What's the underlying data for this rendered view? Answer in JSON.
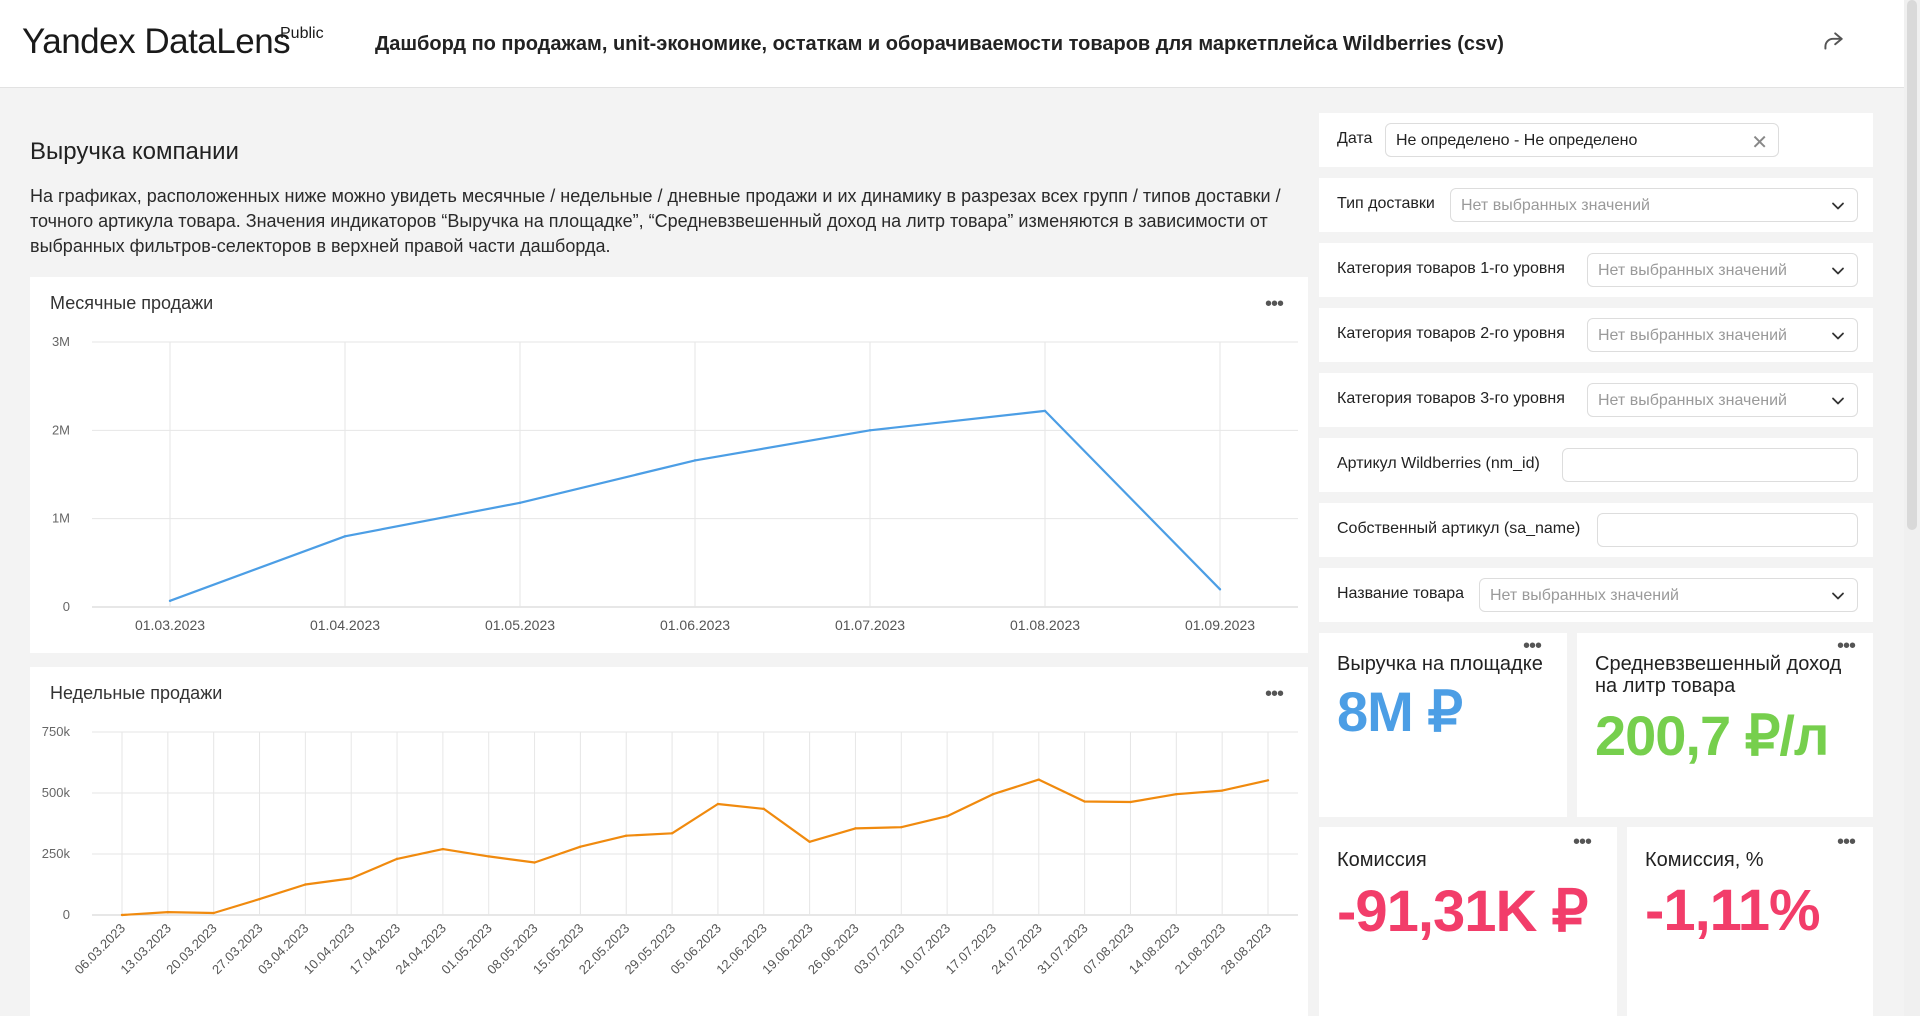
{
  "header": {
    "logo": "Yandex DataLens",
    "badge": "Public",
    "title": "Дашборд по продажам, unit-экономике, остаткам и оборачиваемости товаров для маркетплейса Wildberries (csv)"
  },
  "section": {
    "title": "Выручка компании",
    "description": "На графиках, расположенных ниже можно увидеть месячные / недельные / дневные продажи и их динамику в разрезах всех групп / типов доставки / точного артикула товара. Значения индикаторов “Выручка на площадке”, “Средневзвешенный доход на литр товара” изменяются в зависимости от выбранных фильтров-селекторов в верхней правой части дашборда."
  },
  "colors": {
    "line_monthly": "#4c9ee5",
    "line_weekly": "#f08a0e",
    "kpi_blue": "#4c9ee5",
    "kpi_green": "#76cf4d",
    "kpi_red": "#f23d6a"
  },
  "chart_data": [
    {
      "type": "line",
      "title": "Месячные продажи",
      "x": [
        "01.03.2023",
        "01.04.2023",
        "01.05.2023",
        "01.06.2023",
        "01.07.2023",
        "01.08.2023",
        "01.09.2023"
      ],
      "values": [
        70000,
        800000,
        1180000,
        1660000,
        2000000,
        2220000,
        200000
      ],
      "yticks": [
        "0",
        "1M",
        "2M",
        "3M"
      ],
      "ylim": [
        0,
        3000000
      ],
      "grid": true
    },
    {
      "type": "line",
      "title": "Недельные продажи",
      "x": [
        "06.03.2023",
        "13.03.2023",
        "20.03.2023",
        "27.03.2023",
        "03.04.2023",
        "10.04.2023",
        "17.04.2023",
        "24.04.2023",
        "01.05.2023",
        "08.05.2023",
        "15.05.2023",
        "22.05.2023",
        "29.05.2023",
        "05.06.2023",
        "12.06.2023",
        "19.06.2023",
        "26.06.2023",
        "03.07.2023",
        "10.07.2023",
        "17.07.2023",
        "24.07.2023",
        "31.07.2023",
        "07.08.2023",
        "14.08.2023",
        "21.08.2023",
        "28.08.2023"
      ],
      "values": [
        0,
        12000,
        8000,
        65000,
        125000,
        150000,
        230000,
        270000,
        240000,
        215000,
        280000,
        325000,
        335000,
        455000,
        435000,
        300000,
        355000,
        360000,
        405000,
        495000,
        555000,
        465000,
        463000,
        495000,
        510000,
        552000
      ],
      "yticks": [
        "0",
        "250k",
        "500k",
        "750k"
      ],
      "ylim": [
        0,
        750000
      ],
      "grid": true
    }
  ],
  "filters": [
    {
      "label": "Дата",
      "value": "Не определено - Не определено",
      "kind": "date"
    },
    {
      "label": "Тип доставки",
      "placeholder": "Нет выбранных значений",
      "kind": "select"
    },
    {
      "label": "Категория товаров 1-го уровня",
      "placeholder": "Нет выбранных значений",
      "kind": "select"
    },
    {
      "label": "Категория товаров 2-го уровня",
      "placeholder": "Нет выбранных значений",
      "kind": "select"
    },
    {
      "label": "Категория товаров 3-го уровня",
      "placeholder": "Нет выбранных значений",
      "kind": "select"
    },
    {
      "label": "Артикул Wildberries (nm_id)",
      "value": "",
      "kind": "input"
    },
    {
      "label": "Собственный артикул (sa_name)",
      "value": "",
      "kind": "input"
    },
    {
      "label": "Название товара",
      "placeholder": "Нет выбранных значений",
      "kind": "select"
    }
  ],
  "kpis": {
    "revenue": {
      "title": "Выручка на площадке",
      "value": "8M ₽"
    },
    "income_per_liter": {
      "title": "Средневзвешенный доход на литр товара",
      "value": "200,7 ₽/л"
    },
    "commission": {
      "title": "Комиссия",
      "value": "-91,31K ₽"
    },
    "commission_pct": {
      "title": "Комиссия, %",
      "value": "-1,11%"
    }
  }
}
